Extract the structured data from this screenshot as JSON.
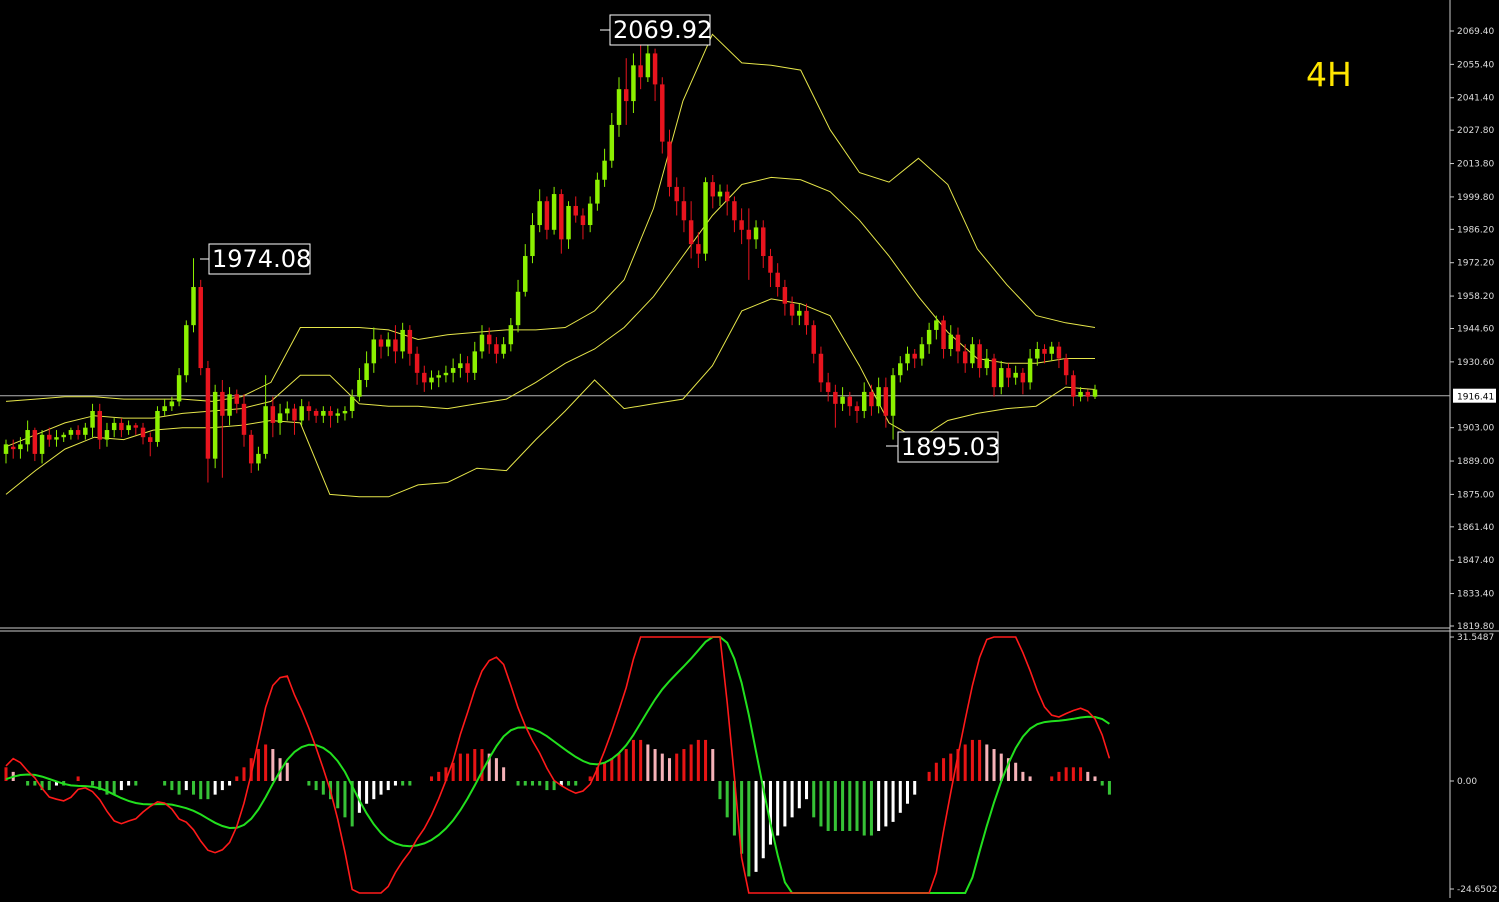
{
  "timeframe_label": "4H",
  "current_price_label": "1916.41",
  "annotations": [
    {
      "name": "high-label-1974",
      "text": "1974.08"
    },
    {
      "name": "high-label-2069",
      "text": "2069.92"
    },
    {
      "name": "low-label-1895",
      "text": "1895.03"
    }
  ],
  "colors": {
    "background": "#000000",
    "bull_candle": "#8CF000",
    "bear_candle": "#E8141E",
    "bollinger": "#E6E64A",
    "timeframe": "#FFE600",
    "macd_fast": "#FF1A1A",
    "macd_signal": "#22E01E",
    "hist_pos_strong": "#E81414",
    "hist_pos_weak": "#F6B2B8",
    "hist_neg_strong": "#36C236",
    "hist_neg_weak": "#FFFFFF",
    "axis_text": "#DDDDDD"
  },
  "chart_data": [
    {
      "type": "candlestick",
      "price_axis": {
        "ticks": [
          "2069.40",
          "2055.40",
          "2041.40",
          "2027.80",
          "2013.80",
          "1999.80",
          "1986.20",
          "1972.20",
          "1958.20",
          "1944.60",
          "1930.60",
          "1916.41",
          "1903.00",
          "1889.00",
          "1875.00",
          "1861.40",
          "1847.40",
          "1833.40",
          "1819.80"
        ],
        "range": [
          1819.8,
          2069.4
        ]
      },
      "horizontal_line": 1916.41,
      "candles": [
        [
          1892,
          1896,
          1888,
          1898
        ],
        [
          1895,
          1894,
          1890,
          1898
        ],
        [
          1894,
          1896,
          1890,
          1899
        ],
        [
          1896,
          1902,
          1893,
          1906
        ],
        [
          1902,
          1892,
          1889,
          1903
        ],
        [
          1892,
          1900,
          1888,
          1902
        ],
        [
          1900,
          1898,
          1895,
          1903
        ],
        [
          1898,
          1899,
          1895,
          1902
        ],
        [
          1899,
          1900,
          1897,
          1901
        ],
        [
          1900,
          1902,
          1898,
          1903
        ],
        [
          1902,
          1900,
          1898,
          1904
        ],
        [
          1900,
          1903,
          1898,
          1905
        ],
        [
          1903,
          1910,
          1899,
          1913
        ],
        [
          1910,
          1898,
          1894,
          1913
        ],
        [
          1898,
          1902,
          1895,
          1905
        ],
        [
          1902,
          1905,
          1899,
          1907
        ],
        [
          1905,
          1902,
          1899,
          1907
        ],
        [
          1902,
          1904,
          1900,
          1906
        ],
        [
          1904,
          1903,
          1900,
          1905
        ],
        [
          1903,
          1899,
          1896,
          1905
        ],
        [
          1899,
          1897,
          1891,
          1901
        ],
        [
          1897,
          1910,
          1895,
          1912
        ],
        [
          1910,
          1912,
          1908,
          1915
        ],
        [
          1912,
          1914,
          1910,
          1916
        ],
        [
          1914,
          1925,
          1912,
          1928
        ],
        [
          1925,
          1946,
          1922,
          1948
        ],
        [
          1946,
          1962,
          1943,
          1974.08
        ],
        [
          1962,
          1928,
          1925,
          1965
        ],
        [
          1928,
          1890,
          1880,
          1931
        ],
        [
          1890,
          1918,
          1886,
          1921
        ],
        [
          1918,
          1908,
          1882,
          1923
        ],
        [
          1908,
          1917,
          1904,
          1920
        ],
        [
          1917,
          1913,
          1909,
          1919
        ],
        [
          1913,
          1900,
          1895,
          1917
        ],
        [
          1900,
          1888,
          1884,
          1902
        ],
        [
          1888,
          1892,
          1885,
          1895
        ],
        [
          1892,
          1912,
          1890,
          1925
        ],
        [
          1912,
          1905,
          1899,
          1916
        ],
        [
          1905,
          1909,
          1900,
          1913
        ],
        [
          1909,
          1911,
          1906,
          1914
        ],
        [
          1911,
          1906,
          1900,
          1913
        ],
        [
          1906,
          1912,
          1904,
          1915
        ],
        [
          1912,
          1910,
          1906,
          1914
        ],
        [
          1910,
          1908,
          1905,
          1911
        ],
        [
          1908,
          1910,
          1905,
          1912
        ],
        [
          1910,
          1908,
          1903,
          1912
        ],
        [
          1908,
          1909,
          1905,
          1911
        ],
        [
          1909,
          1910,
          1906,
          1912
        ],
        [
          1910,
          1916,
          1907,
          1919
        ],
        [
          1916,
          1923,
          1914,
          1928
        ],
        [
          1923,
          1930,
          1920,
          1935
        ],
        [
          1930,
          1940,
          1926,
          1945
        ],
        [
          1940,
          1937,
          1932,
          1942
        ],
        [
          1937,
          1940,
          1933,
          1943
        ],
        [
          1940,
          1935,
          1930,
          1946
        ],
        [
          1935,
          1944,
          1932,
          1947
        ],
        [
          1944,
          1934,
          1929,
          1946
        ],
        [
          1934,
          1926,
          1921,
          1937
        ],
        [
          1926,
          1922,
          1918,
          1929
        ],
        [
          1922,
          1924,
          1919,
          1927
        ],
        [
          1924,
          1925,
          1920,
          1927
        ],
        [
          1925,
          1926,
          1922,
          1929
        ],
        [
          1926,
          1928,
          1922,
          1932
        ],
        [
          1928,
          1930,
          1924,
          1934
        ],
        [
          1930,
          1926,
          1922,
          1933
        ],
        [
          1926,
          1935,
          1923,
          1939
        ],
        [
          1935,
          1942,
          1932,
          1946
        ],
        [
          1942,
          1938,
          1934,
          1945
        ],
        [
          1938,
          1934,
          1930,
          1941
        ],
        [
          1934,
          1938,
          1932,
          1941
        ],
        [
          1938,
          1946,
          1935,
          1949
        ],
        [
          1946,
          1960,
          1943,
          1965
        ],
        [
          1960,
          1975,
          1958,
          1980
        ],
        [
          1975,
          1988,
          1972,
          1993
        ],
        [
          1988,
          1998,
          1985,
          2003
        ],
        [
          1998,
          1986,
          1982,
          2000
        ],
        [
          1986,
          2001,
          1984,
          2004
        ],
        [
          2001,
          1982,
          1976,
          2003
        ],
        [
          1982,
          1996,
          1978,
          1998
        ],
        [
          1996,
          1992,
          1989,
          2000
        ],
        [
          1992,
          1988,
          1982,
          1995
        ],
        [
          1988,
          1997,
          1985,
          2000
        ],
        [
          1997,
          2007,
          1994,
          2010
        ],
        [
          2007,
          2015,
          2004,
          2020
        ],
        [
          2015,
          2030,
          2012,
          2035
        ],
        [
          2030,
          2045,
          2025,
          2050
        ],
        [
          2045,
          2040,
          2030,
          2058
        ],
        [
          2040,
          2055,
          2035,
          2060
        ],
        [
          2055,
          2050,
          2045,
          2066
        ],
        [
          2050,
          2060,
          2048,
          2065
        ],
        [
          2060,
          2047,
          2040,
          2062
        ],
        [
          2047,
          2023,
          2018,
          2050
        ],
        [
          2023,
          2004,
          2000,
          2028
        ],
        [
          2004,
          1998,
          1992,
          2008
        ],
        [
          1998,
          1990,
          1985,
          2004
        ],
        [
          1990,
          1980,
          1974,
          1998
        ],
        [
          1980,
          1976,
          1970,
          1985
        ],
        [
          1976,
          2006,
          1973,
          2008
        ],
        [
          2006,
          2000,
          1995,
          2009
        ],
        [
          2000,
          2002,
          1996,
          2005
        ],
        [
          2002,
          1998,
          1992,
          2005
        ],
        [
          1998,
          1990,
          1985,
          2000
        ],
        [
          1990,
          1986,
          1980,
          1995
        ],
        [
          1986,
          1982,
          1965,
          1995
        ],
        [
          1982,
          1987,
          1978,
          1990
        ],
        [
          1987,
          1975,
          1970,
          1990
        ],
        [
          1975,
          1968,
          1962,
          1978
        ],
        [
          1968,
          1962,
          1958,
          1972
        ],
        [
          1962,
          1955,
          1950,
          1965
        ],
        [
          1955,
          1950,
          1946,
          1958
        ],
        [
          1950,
          1952,
          1946,
          1955
        ],
        [
          1952,
          1946,
          1942,
          1955
        ],
        [
          1946,
          1934,
          1930,
          1948
        ],
        [
          1934,
          1922,
          1918,
          1937
        ],
        [
          1922,
          1918,
          1914,
          1926
        ],
        [
          1918,
          1913,
          1903,
          1921
        ],
        [
          1913,
          1916,
          1910,
          1920
        ],
        [
          1916,
          1912,
          1908,
          1918
        ],
        [
          1912,
          1910,
          1905,
          1914
        ],
        [
          1910,
          1918,
          1907,
          1922
        ],
        [
          1918,
          1912,
          1908,
          1921
        ],
        [
          1912,
          1920,
          1909,
          1924
        ],
        [
          1920,
          1908,
          1903,
          1924
        ],
        [
          1908,
          1925,
          1898,
          1928
        ],
        [
          1925,
          1930,
          1922,
          1933
        ],
        [
          1930,
          1934,
          1927,
          1937
        ],
        [
          1934,
          1932,
          1928,
          1936
        ],
        [
          1932,
          1938,
          1929,
          1941
        ],
        [
          1938,
          1944,
          1934,
          1947
        ],
        [
          1944,
          1948,
          1940,
          1950
        ],
        [
          1948,
          1936,
          1932,
          1950
        ],
        [
          1936,
          1942,
          1933,
          1946
        ],
        [
          1942,
          1935,
          1930,
          1945
        ],
        [
          1935,
          1930,
          1926,
          1938
        ],
        [
          1930,
          1938,
          1928,
          1941
        ],
        [
          1938,
          1928,
          1924,
          1940
        ],
        [
          1928,
          1932,
          1925,
          1936
        ],
        [
          1932,
          1920,
          1916,
          1934
        ],
        [
          1920,
          1928,
          1917,
          1931
        ],
        [
          1928,
          1924,
          1920,
          1930
        ],
        [
          1924,
          1926,
          1921,
          1929
        ],
        [
          1926,
          1922,
          1917,
          1928
        ],
        [
          1922,
          1932,
          1919,
          1936
        ],
        [
          1932,
          1936,
          1929,
          1939
        ],
        [
          1936,
          1934,
          1930,
          1938
        ],
        [
          1934,
          1937,
          1931,
          1939
        ],
        [
          1937,
          1932,
          1928,
          1939
        ],
        [
          1932,
          1925,
          1921,
          1934
        ],
        [
          1925,
          1916,
          1912,
          1927
        ],
        [
          1916,
          1918,
          1914,
          1920
        ],
        [
          1918,
          1916,
          1914,
          1919
        ],
        [
          1916,
          1919,
          1915,
          1921
        ]
      ],
      "bollinger": {
        "upper": [
          1914,
          1915,
          1916,
          1916,
          1915,
          1915,
          1915,
          1914,
          1916,
          1922,
          1945,
          1945,
          1945,
          1944,
          1940,
          1942,
          1943,
          1944,
          1944,
          1945,
          1952,
          1965,
          1995,
          2040,
          2068,
          2056,
          2055,
          2053,
          2028,
          2010,
          2006,
          2016,
          2005,
          1978,
          1963,
          1950,
          1947,
          1945
        ],
        "mid": [
          1895,
          1900,
          1905,
          1908,
          1907,
          1907,
          1909,
          1910,
          1911,
          1914,
          1925,
          1925,
          1913,
          1912,
          1912,
          1911,
          1913,
          1915,
          1922,
          1930,
          1936,
          1945,
          1958,
          1975,
          1992,
          2005,
          2008,
          2007,
          2002,
          1990,
          1975,
          1958,
          1943,
          1932,
          1930,
          1930,
          1932,
          1932
        ],
        "lower": [
          1875,
          1885,
          1894,
          1899,
          1898,
          1902,
          1903,
          1903,
          1904,
          1906,
          1905,
          1875,
          1874,
          1874,
          1879,
          1880,
          1886,
          1885,
          1898,
          1910,
          1923,
          1911,
          1913,
          1915,
          1929,
          1952,
          1957,
          1955,
          1950,
          1929,
          1905,
          1898,
          1906,
          1909,
          1911,
          1912,
          1920,
          1919
        ]
      }
    },
    {
      "type": "macd",
      "axis": {
        "ticks": [
          "31.5487",
          "0.00",
          "-24.6502"
        ],
        "range": [
          -24.6502,
          31.5487
        ]
      },
      "histogram": [
        3,
        2,
        0,
        -1,
        -1,
        -2,
        -2,
        -1,
        -1,
        0,
        1,
        0,
        -1,
        -2,
        -3,
        -3,
        -2,
        -1,
        -1,
        0,
        0,
        0,
        -1,
        -2,
        -3,
        -2,
        -3,
        -4,
        -4,
        -3,
        -2,
        -1,
        1,
        3,
        5,
        7,
        8,
        7,
        5,
        4,
        0,
        0,
        -1,
        -2,
        -3,
        -4,
        -6,
        -8,
        -10,
        -7,
        -5,
        -4,
        -3,
        -2,
        -1,
        -1,
        -1,
        0,
        0,
        1,
        2,
        3,
        4,
        6,
        6,
        7,
        7,
        6,
        5,
        3,
        0,
        -1,
        -1,
        -1,
        -1,
        -2,
        -2,
        -1,
        -1,
        -1,
        0,
        1,
        3,
        4,
        5,
        6,
        7,
        9,
        9,
        8,
        7,
        6,
        5,
        6,
        7,
        8,
        9,
        9,
        7,
        -4,
        -8,
        -12,
        -16,
        -21,
        -20,
        -17,
        -14,
        -12,
        -10,
        -8,
        -6,
        -4,
        -8,
        -10,
        -11,
        -11,
        -11,
        -11,
        -11,
        -12,
        -12,
        -11,
        -10,
        -9,
        -7,
        -5,
        -3,
        0,
        2,
        4,
        5,
        6,
        7,
        8,
        9,
        9,
        8,
        7,
        6,
        5,
        4,
        2,
        1,
        0,
        0,
        1,
        2,
        3,
        3,
        3,
        2,
        1,
        -1,
        -3
      ]
    }
  ]
}
